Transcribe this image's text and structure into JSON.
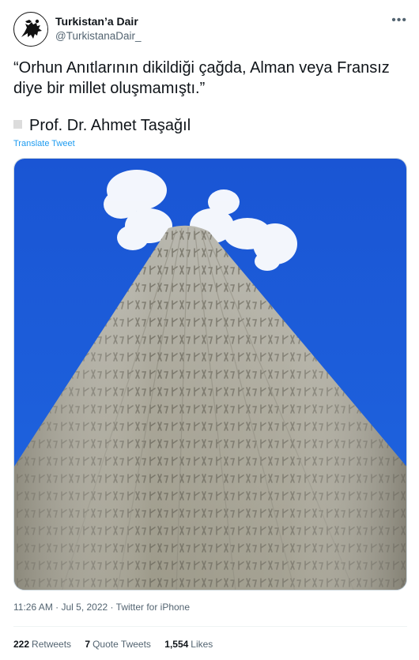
{
  "account": {
    "name": "Turkistan’a Dair",
    "handle": "@TurkistanaDair_"
  },
  "more_icon": "more-horizontal-icon",
  "tweet": {
    "text": "“Orhun Anıtlarının dikildiği çağda, Alman veya Fransız\ndiye bir millet oluşmamıştı.”",
    "author": "Prof. Dr. Ahmet Taşağıl",
    "translate_label": "Translate Tweet"
  },
  "media": {
    "description_icon": "photo-orkhon-inscription-stone"
  },
  "meta": {
    "time": "11:26 AM",
    "separator1": " · ",
    "date": "Jul 5, 2022",
    "separator2": " · ",
    "source": "Twitter for iPhone"
  },
  "stats": {
    "retweets_count": "222",
    "retweets_label": "Retweets",
    "quotes_count": "7",
    "quotes_label": "Quote Tweets",
    "likes_count": "1,554",
    "likes_label": "Likes"
  },
  "colors": {
    "link": "#1d9bf0",
    "secondary": "#536471",
    "sky": "#1f5fd8"
  }
}
